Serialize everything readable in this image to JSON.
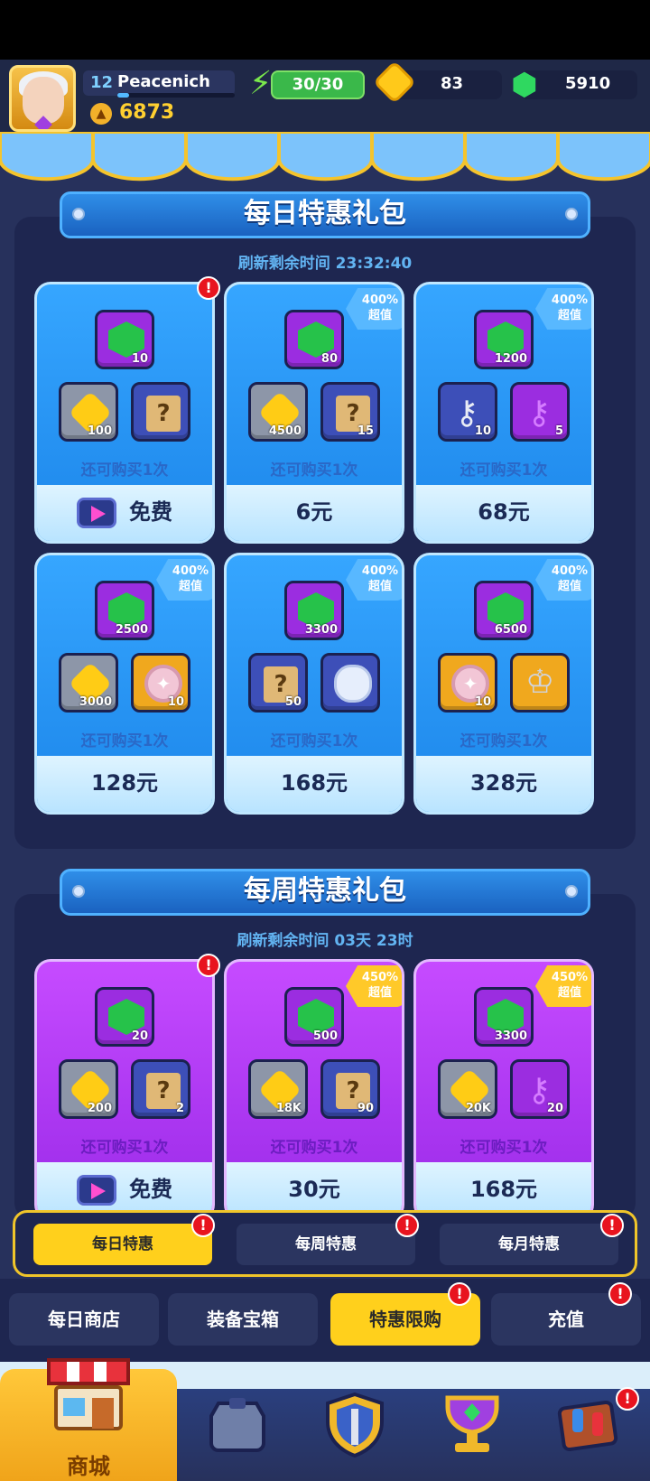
{
  "player": {
    "level": "12",
    "name": "Peacenich",
    "xp_fraction": 0.1,
    "trophies": "6873"
  },
  "resources": {
    "energy": "30/30",
    "gold": "83",
    "gems": "5910"
  },
  "daily": {
    "title": "每日特惠礼包",
    "timer": "刷新剩余时间 23:32:40",
    "cards": [
      {
        "gem": "10",
        "items": [
          {
            "type": "gold",
            "count": "100"
          },
          {
            "type": "scroll",
            "count": ""
          }
        ],
        "remaining": "还可购买1次",
        "price": "免费",
        "badge": "",
        "alert": true
      },
      {
        "gem": "80",
        "items": [
          {
            "type": "gold",
            "count": "4500"
          },
          {
            "type": "scroll",
            "count": "15"
          }
        ],
        "remaining": "还可购买1次",
        "price": "6元",
        "badge": "400%|超值",
        "alert": false
      },
      {
        "gem": "1200",
        "items": [
          {
            "type": "silver-key",
            "count": "10"
          },
          {
            "type": "purple-key",
            "count": "5"
          }
        ],
        "remaining": "还可购买1次",
        "price": "68元",
        "badge": "400%|超值",
        "alert": false
      },
      {
        "gem": "2500",
        "items": [
          {
            "type": "gold",
            "count": "3000"
          },
          {
            "type": "medal",
            "count": "10"
          }
        ],
        "remaining": "还可购买1次",
        "price": "128元",
        "badge": "400%|超值",
        "alert": false
      },
      {
        "gem": "3300",
        "items": [
          {
            "type": "scroll",
            "count": "50"
          },
          {
            "type": "hero",
            "count": ""
          }
        ],
        "remaining": "还可购买1次",
        "price": "168元",
        "badge": "400%|超值",
        "alert": false
      },
      {
        "gem": "6500",
        "items": [
          {
            "type": "medal",
            "count": "10"
          },
          {
            "type": "cup",
            "count": ""
          }
        ],
        "remaining": "还可购买1次",
        "price": "328元",
        "badge": "400%|超值",
        "alert": false
      }
    ]
  },
  "weekly": {
    "title": "每周特惠礼包",
    "timer": "刷新剩余时间 03天 23时",
    "cards": [
      {
        "gem": "20",
        "items": [
          {
            "type": "gold",
            "count": "200"
          },
          {
            "type": "scroll",
            "count": "2"
          }
        ],
        "remaining": "还可购买1次",
        "price": "免费",
        "badge": "",
        "alert": true
      },
      {
        "gem": "500",
        "items": [
          {
            "type": "gold",
            "count": "18K"
          },
          {
            "type": "scroll",
            "count": "90"
          }
        ],
        "remaining": "还可购买1次",
        "price": "30元",
        "badge": "450%|超值",
        "alert": false
      },
      {
        "gem": "3300",
        "items": [
          {
            "type": "gold",
            "count": "20K"
          },
          {
            "type": "purple-key",
            "count": "20"
          }
        ],
        "remaining": "还可购买1次",
        "price": "168元",
        "badge": "450%|超值",
        "alert": false
      }
    ]
  },
  "subtabs": [
    {
      "label": "每日特惠",
      "active": true
    },
    {
      "label": "每周特惠",
      "active": false
    },
    {
      "label": "每月特惠",
      "active": false
    }
  ],
  "nav": [
    {
      "label": "每日商店",
      "active": false,
      "alert": false
    },
    {
      "label": "装备宝箱",
      "active": false,
      "alert": false
    },
    {
      "label": "特惠限购",
      "active": true,
      "alert": true
    },
    {
      "label": "充值",
      "active": false,
      "alert": true
    }
  ],
  "bottom": {
    "home_label": "商城"
  },
  "alert_glyph": "!",
  "colors": {
    "accent": "#ffd01c",
    "alert": "#e8141f",
    "daily_card": "#2a9cf8",
    "weekly_card": "#b23df5"
  }
}
